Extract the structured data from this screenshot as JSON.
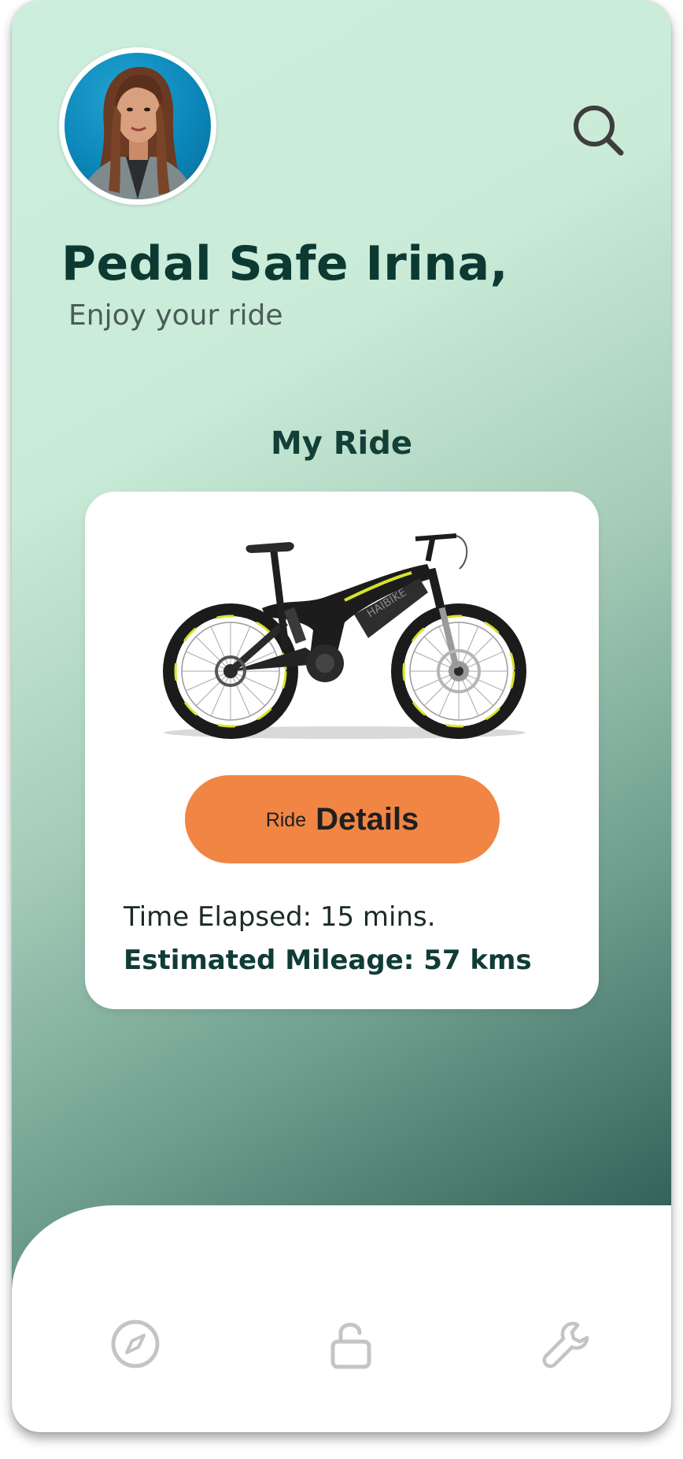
{
  "header": {
    "greeting": "Pedal Safe Irina,",
    "subtitle": "Enjoy your ride"
  },
  "icons": {
    "search": "search-icon",
    "nav": [
      "compass-icon",
      "unlock-icon",
      "wrench-icon"
    ]
  },
  "ride": {
    "section_title": "My Ride",
    "button_small": "Ride",
    "button_big": "Details",
    "time_elapsed": "Time Elapsed: 15 mins.",
    "mileage": "Estimated Mileage: 57 kms"
  },
  "colors": {
    "accent": "#f08544",
    "text_dark": "#0c3a33",
    "bike_highlight": "#d7e22a"
  }
}
